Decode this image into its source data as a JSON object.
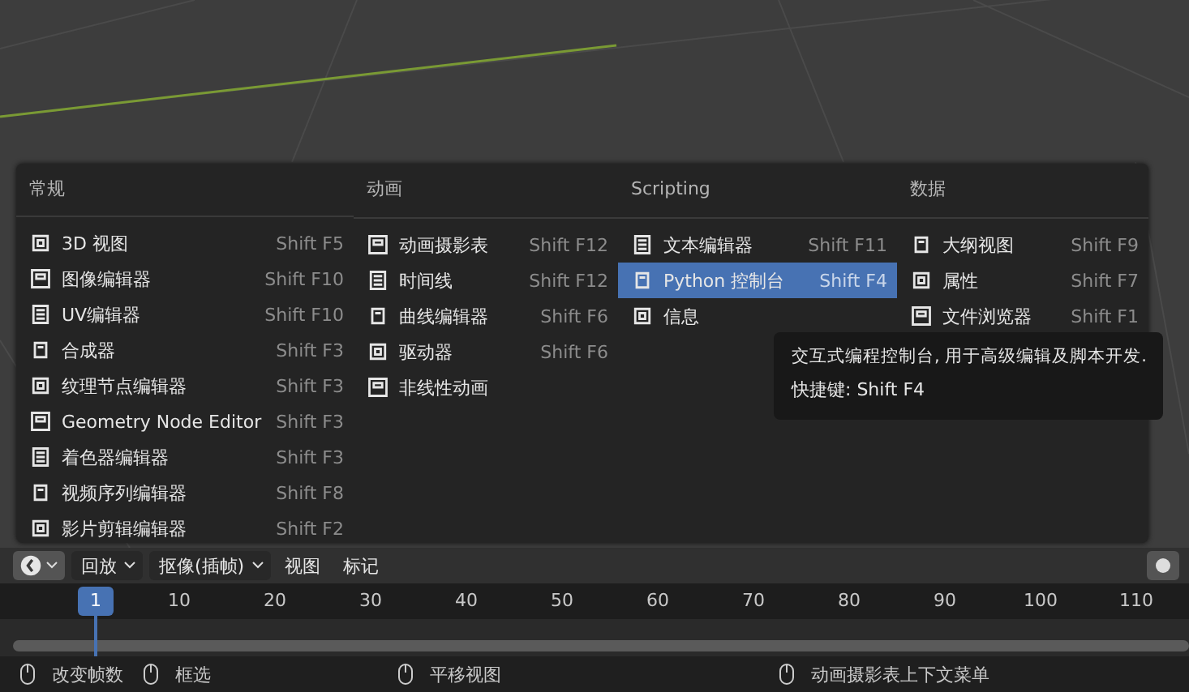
{
  "menu": {
    "columns": [
      {
        "title": "常规",
        "items": [
          {
            "label": "3D 视图",
            "shortcut": "Shift F5",
            "selected": false
          },
          {
            "label": "图像编辑器",
            "shortcut": "Shift F10",
            "selected": false
          },
          {
            "label": "UV编辑器",
            "shortcut": "Shift F10",
            "selected": false
          },
          {
            "label": "合成器",
            "shortcut": "Shift F3",
            "selected": false
          },
          {
            "label": "纹理节点编辑器",
            "shortcut": "Shift F3",
            "selected": false
          },
          {
            "label": "Geometry Node Editor",
            "shortcut": "Shift F3",
            "selected": false
          },
          {
            "label": "着色器编辑器",
            "shortcut": "Shift F3",
            "selected": false
          },
          {
            "label": "视频序列编辑器",
            "shortcut": "Shift F8",
            "selected": false
          },
          {
            "label": "影片剪辑编辑器",
            "shortcut": "Shift F2",
            "selected": false
          }
        ]
      },
      {
        "title": "动画",
        "items": [
          {
            "label": "动画摄影表",
            "shortcut": "Shift F12",
            "selected": false
          },
          {
            "label": "时间线",
            "shortcut": "Shift F12",
            "selected": false
          },
          {
            "label": "曲线编辑器",
            "shortcut": "Shift F6",
            "selected": false
          },
          {
            "label": "驱动器",
            "shortcut": "Shift F6",
            "selected": false
          },
          {
            "label": "非线性动画",
            "selected": false
          }
        ]
      },
      {
        "title": "Scripting",
        "items": [
          {
            "label": "文本编辑器",
            "shortcut": "Shift F11",
            "selected": false
          },
          {
            "label": "Python 控制台",
            "shortcut": "Shift F4",
            "selected": true
          },
          {
            "label": "信息",
            "selected": false
          }
        ]
      },
      {
        "title": "数据",
        "items": [
          {
            "label": "大纲视图",
            "shortcut": "Shift F9",
            "selected": false
          },
          {
            "label": "属性",
            "shortcut": "Shift F7",
            "selected": false
          },
          {
            "label": "文件浏览器",
            "shortcut": "Shift F1",
            "selected": false
          }
        ]
      }
    ]
  },
  "tooltip": {
    "description": "交互式编程控制台, 用于高级编辑及脚本开发.",
    "shortcut": "快捷键: Shift F4"
  },
  "timeline_header": {
    "dropdowns": [
      "回放",
      "抠像(插帧)"
    ],
    "menus": [
      "视图",
      "标记"
    ]
  },
  "ruler": {
    "current_frame": "1",
    "ticks": [
      "10",
      "20",
      "30",
      "40",
      "50",
      "60",
      "70",
      "80",
      "90",
      "100",
      "110"
    ]
  },
  "status_bar": [
    {
      "label": "改变帧数"
    },
    {
      "label": "框选"
    },
    {
      "label": "平移视图"
    },
    {
      "label": "动画摄影表上下文菜单"
    }
  ]
}
